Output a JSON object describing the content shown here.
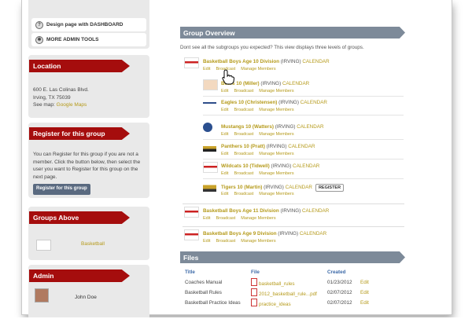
{
  "admin_tools": {
    "design_page": "Design page with DASHBOARD",
    "more_admin": "MORE ADMIN TOOLS"
  },
  "location": {
    "title": "Location",
    "address_line1": "600 E. Las Colinas Blvd.",
    "address_line2": "Irving, TX 75039",
    "see_map_prefix": "See map:",
    "map_link": "Google Maps"
  },
  "register": {
    "title": "Register for this group",
    "text": "You can Register for this group if you are not a member. Click the button below, then select the user you want to Register for this group on the next page.",
    "button": "Register for this group"
  },
  "groups_above": {
    "title": "Groups Above",
    "item": "Basketball"
  },
  "admin_panel": {
    "title": "Admin",
    "user": "John Doe"
  },
  "overview": {
    "title": "Group Overview",
    "intro": "Dont see all the subgroups you expected? This view displays three levels of groups.",
    "actions": {
      "edit": "Edit",
      "broadcast": "Broadcast",
      "manage": "Manage Members"
    },
    "calendar": "CALENDAR",
    "register_btn": "REGISTER",
    "groups": [
      {
        "name": "Basketball Boys Age 10 Division",
        "city": "(IRVING)"
      },
      {
        "name": "Bears 10 (Miller)",
        "city": "(IRVING)"
      },
      {
        "name": "Eagles 10 (Christensen)",
        "city": "(IRVING)"
      },
      {
        "name": "Mustangs 10 (Watters)",
        "city": "(IRVING)"
      },
      {
        "name": "Panthers 10 (Pratt)",
        "city": "(IRVING)"
      },
      {
        "name": "Wildcats 10 (Tidwell)",
        "city": "(IRVING)"
      },
      {
        "name": "Tigers 10 (Martin)",
        "city": "(IRVING)"
      },
      {
        "name": "Basketball Boys Age 11 Division",
        "city": "(IRVING)"
      },
      {
        "name": "Basketball Boys Age 9 Division",
        "city": "(IRVING)"
      }
    ]
  },
  "files": {
    "title": "Files",
    "headers": {
      "title": "Title",
      "file": "File",
      "created": "Created"
    },
    "rows": [
      {
        "title": "Coaches Manual",
        "file": "basketball_rules",
        "created": "01/23/2012",
        "action": "Edit"
      },
      {
        "title": "Basketball Rules",
        "file": "2012_basketball_rule...pdf",
        "created": "02/07/2012",
        "action": "Edit"
      },
      {
        "title": "Basketball Practice Ideas",
        "file": "practice_ideas",
        "created": "02/07/2012",
        "action": "Edit"
      }
    ]
  },
  "colors": {
    "ribbon": "#a50d0d",
    "section_bar": "#7d8a99",
    "link_gold": "#b59a1a",
    "header_blue": "#3d6aa8"
  }
}
